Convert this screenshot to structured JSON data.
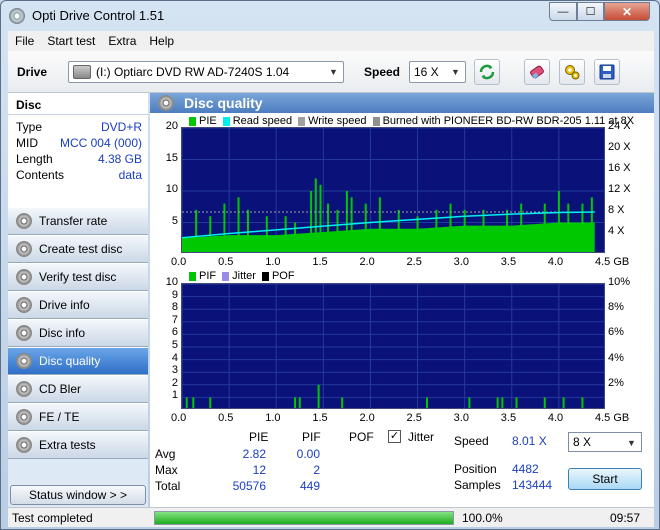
{
  "window": {
    "title": "Opti Drive Control 1.51",
    "min": "—",
    "max": "☐",
    "close": "✕"
  },
  "menu": [
    "File",
    "Start test",
    "Extra",
    "Help"
  ],
  "toolbar": {
    "drive_label": "Drive",
    "drive_value": "(I:)  Optiarc DVD RW AD-7240S 1.04",
    "speed_label": "Speed",
    "speed_value": "16 X",
    "icons": [
      "refresh-icon",
      "eraser-icon",
      "settings-icon",
      "save-icon"
    ]
  },
  "sidebar": {
    "disc_title": "Disc",
    "info": [
      {
        "label": "Type",
        "value": "DVD+R"
      },
      {
        "label": "MID",
        "value": "MCC 004 (000)"
      },
      {
        "label": "Length",
        "value": "4.38 GB"
      },
      {
        "label": "Contents",
        "value": "data"
      }
    ],
    "nav": [
      {
        "label": "Transfer rate",
        "active": false
      },
      {
        "label": "Create test disc",
        "active": false
      },
      {
        "label": "Verify test disc",
        "active": false
      },
      {
        "label": "Drive info",
        "active": false
      },
      {
        "label": "Disc info",
        "active": false
      },
      {
        "label": "Disc quality",
        "active": true
      },
      {
        "label": "CD Bler",
        "active": false
      },
      {
        "label": "FE / TE",
        "active": false
      },
      {
        "label": "Extra tests",
        "active": false
      }
    ],
    "status_button": "Status window > >"
  },
  "panel": {
    "title": "Disc quality"
  },
  "chart_data": [
    {
      "type": "area",
      "legend": [
        {
          "label": "PIE",
          "color": "#00c800"
        },
        {
          "label": "Read speed",
          "color": "#00f0f0"
        },
        {
          "label": "Write speed",
          "color": "#a0a0a0"
        },
        {
          "label": "Burned with PIONEER BD-RW   BDR-205 1.11 at 8X",
          "color": "#909090"
        }
      ],
      "x_ticks": [
        "0.0",
        "0.5",
        "1.0",
        "1.5",
        "2.0",
        "2.5",
        "3.0",
        "3.5",
        "4.0",
        "4.5 GB"
      ],
      "y_ticks_left": [
        "20",
        "15",
        "10",
        "5"
      ],
      "y_ticks_right": [
        "24 X",
        "20 X",
        "16 X",
        "12 X",
        "8 X",
        "4 X"
      ],
      "xlim": [
        0,
        4.5
      ],
      "ylim": [
        0,
        20
      ],
      "y2lim": [
        0,
        24
      ],
      "pie_baseline": [
        [
          0,
          2.5
        ],
        [
          0.5,
          3
        ],
        [
          1.0,
          3
        ],
        [
          1.5,
          3.5
        ],
        [
          2.0,
          4
        ],
        [
          2.5,
          4
        ],
        [
          3.0,
          4.5
        ],
        [
          3.5,
          4.5
        ],
        [
          4.0,
          5
        ],
        [
          4.38,
          5
        ]
      ],
      "pie_spikes": [
        [
          0.15,
          7
        ],
        [
          0.3,
          6
        ],
        [
          0.45,
          8
        ],
        [
          0.6,
          9
        ],
        [
          0.7,
          7
        ],
        [
          0.9,
          6
        ],
        [
          1.1,
          6
        ],
        [
          1.2,
          5
        ],
        [
          1.37,
          10
        ],
        [
          1.42,
          12
        ],
        [
          1.47,
          11
        ],
        [
          1.55,
          8
        ],
        [
          1.65,
          7
        ],
        [
          1.75,
          10
        ],
        [
          1.8,
          9
        ],
        [
          1.95,
          8
        ],
        [
          2.1,
          9
        ],
        [
          2.3,
          7
        ],
        [
          2.5,
          6
        ],
        [
          2.7,
          7
        ],
        [
          2.85,
          8
        ],
        [
          3.0,
          7
        ],
        [
          3.2,
          7
        ],
        [
          3.45,
          7
        ],
        [
          3.6,
          8
        ],
        [
          3.85,
          8
        ],
        [
          4.0,
          10
        ],
        [
          4.1,
          8
        ],
        [
          4.25,
          8
        ],
        [
          4.35,
          9
        ]
      ],
      "read_speed": [
        [
          0,
          3.1
        ],
        [
          0.5,
          3.9
        ],
        [
          1.0,
          4.6
        ],
        [
          1.5,
          5.3
        ],
        [
          2.0,
          6.0
        ],
        [
          2.5,
          6.6
        ],
        [
          3.0,
          7.2
        ],
        [
          3.5,
          7.6
        ],
        [
          4.0,
          7.9
        ],
        [
          4.38,
          8.0
        ]
      ],
      "write_speed": [
        [
          0,
          8
        ],
        [
          4.38,
          8
        ]
      ]
    },
    {
      "type": "bar",
      "legend": [
        {
          "label": "PIF",
          "color": "#00c800"
        },
        {
          "label": "Jitter",
          "color": "#9b8be6"
        },
        {
          "label": "POF",
          "color": "#000000"
        }
      ],
      "x_ticks": [
        "0.0",
        "0.5",
        "1.0",
        "1.5",
        "2.0",
        "2.5",
        "3.0",
        "3.5",
        "4.0",
        "4.5 GB"
      ],
      "y_ticks_left": [
        "10",
        "9",
        "8",
        "7",
        "6",
        "5",
        "4",
        "3",
        "2",
        "1"
      ],
      "y_ticks_right": [
        "10%",
        "8%",
        "6%",
        "4%",
        "2%"
      ],
      "xlim": [
        0,
        4.5
      ],
      "ylim": [
        0,
        10
      ],
      "pif": [
        [
          0.05,
          1
        ],
        [
          0.12,
          1
        ],
        [
          0.3,
          1
        ],
        [
          1.2,
          1
        ],
        [
          1.25,
          1
        ],
        [
          1.45,
          2
        ],
        [
          1.7,
          1
        ],
        [
          2.6,
          1
        ],
        [
          3.05,
          1
        ],
        [
          3.35,
          1
        ],
        [
          3.4,
          1
        ],
        [
          3.55,
          1
        ],
        [
          3.85,
          1
        ],
        [
          4.05,
          1
        ],
        [
          4.25,
          1
        ]
      ]
    }
  ],
  "stats": {
    "headers": [
      "PIE",
      "PIF",
      "POF",
      "Jitter"
    ],
    "rows": [
      {
        "label": "Avg",
        "pie": "2.82",
        "pif": "0.00"
      },
      {
        "label": "Max",
        "pie": "12",
        "pif": "2"
      },
      {
        "label": "Total",
        "pie": "50576",
        "pif": "449"
      }
    ],
    "jitter_checked": true,
    "speed_label": "Speed",
    "speed_value": "8.01 X",
    "position_label": "Position",
    "position_value": "4482",
    "samples_label": "Samples",
    "samples_value": "143444",
    "speed_select": "8 X",
    "start": "Start"
  },
  "status": {
    "text": "Test completed",
    "progress": 100.0,
    "progress_text": "100.0%",
    "time": "09:57"
  }
}
